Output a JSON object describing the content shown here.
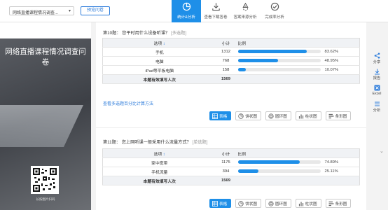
{
  "topbar": {
    "survey_select": "网络直播课程情况调查...",
    "preview_label": "预览问卷",
    "tabs": [
      {
        "label": "统计&分析",
        "icon": "pie-chart-icon",
        "active": true
      },
      {
        "label": "查看下载答卷",
        "icon": "download-icon",
        "active": false
      },
      {
        "label": "答案来源分析",
        "icon": "recycle-icon",
        "active": false
      },
      {
        "label": "完成率分析",
        "icon": "check-circle-icon",
        "active": false
      }
    ]
  },
  "cover": {
    "title": "网络直播课程情况调查问卷",
    "qr_caption": "长按图片扫码"
  },
  "questions": [
    {
      "title": "第10题： 您平时用什么设备听课？",
      "tag": "[多选题]",
      "headers": {
        "option": "选项",
        "count": "小计",
        "ratio": "比例"
      },
      "rows": [
        {
          "option": "手机",
          "count": "1312",
          "pct": "83.62%",
          "value": 83.62
        },
        {
          "option": "电脑",
          "count": "768",
          "pct": "48.95%",
          "value": 48.95
        },
        {
          "option": "iPad等平板电脑",
          "count": "158",
          "pct": "10.07%",
          "value": 10.07
        }
      ],
      "total_label": "本题有效填写人次",
      "total_value": "1569",
      "extra_link": "查看多选题百分比计算方法"
    },
    {
      "title": "第11题： 您上网听课一般采用什么流量方式？",
      "tag": "[单选题]",
      "headers": {
        "option": "选项",
        "count": "小计",
        "ratio": "比例"
      },
      "rows": [
        {
          "option": "家中宽带",
          "count": "1175",
          "pct": "74.89%",
          "value": 74.89
        },
        {
          "option": "手机流量",
          "count": "394",
          "pct": "25.11%",
          "value": 25.11
        }
      ],
      "total_label": "本题有效填写人次",
      "total_value": "1569"
    }
  ],
  "chart_buttons": [
    {
      "label": "表格",
      "icon": "table-icon",
      "active": true
    },
    {
      "label": "饼状图",
      "icon": "pie-icon",
      "active": false
    },
    {
      "label": "圆环图",
      "icon": "ring-icon",
      "active": false
    },
    {
      "label": "柱状图",
      "icon": "bar-chart-icon",
      "active": false
    },
    {
      "label": "条形图",
      "icon": "hbar-chart-icon",
      "active": false
    }
  ],
  "right_bar": [
    {
      "label": "分享",
      "icon": "share-icon"
    },
    {
      "label": "报告",
      "icon": "report-icon"
    },
    {
      "label": "Excel",
      "icon": "excel-icon"
    },
    {
      "label": "分析",
      "icon": "analysis-icon"
    }
  ],
  "colors": {
    "accent": "#1e8fe8",
    "link": "#2f7ddb"
  }
}
